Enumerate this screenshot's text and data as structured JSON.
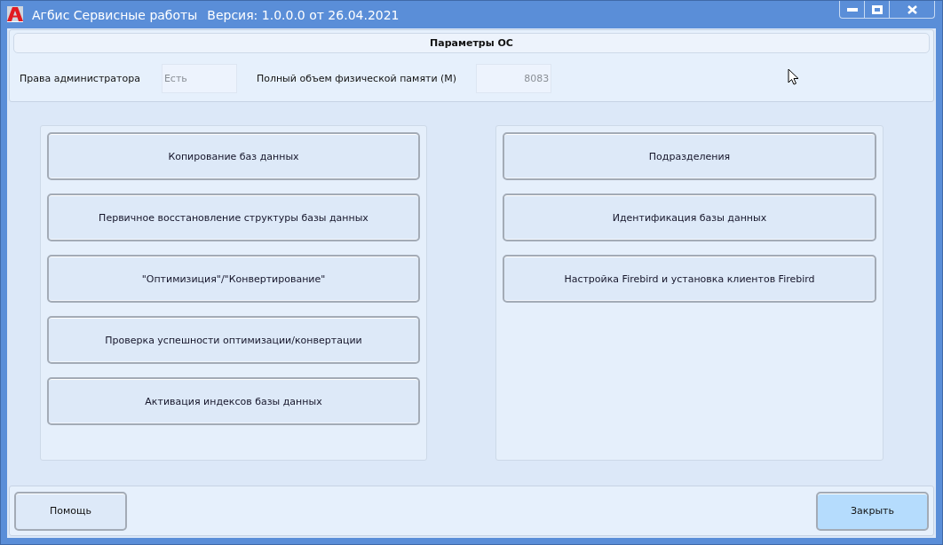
{
  "window": {
    "title": "Агбис Сервисные работы",
    "version": "Версия: 1.0.0.0 от 26.04.2021"
  },
  "os_params": {
    "header": "Параметры ОС",
    "fields": [
      {
        "label": "Права администратора",
        "value": "Есть",
        "kind": "text",
        "disabled": true
      },
      {
        "label": "Полный объем физической памяти (М)",
        "value": "8083",
        "kind": "number",
        "disabled": true
      }
    ]
  },
  "left_actions": [
    {
      "label": "Копирование баз данных"
    },
    {
      "label": "Первичное восстановление структуры базы данных"
    },
    {
      "label": "\"Оптимизиция\"/\"Конвертирование\""
    },
    {
      "label": "Проверка успешности оптимизации/конвертации"
    },
    {
      "label": "Активация индексов базы данных"
    }
  ],
  "right_actions": [
    {
      "label": "Подразделения"
    },
    {
      "label": "Идентификация базы данных"
    },
    {
      "label": "Настройка Firebird и установка клиентов Firebird"
    }
  ],
  "footer_buttons": [
    {
      "label": "Помощь",
      "highlighted": false
    },
    {
      "label": "Закрыть",
      "highlighted": true
    }
  ]
}
